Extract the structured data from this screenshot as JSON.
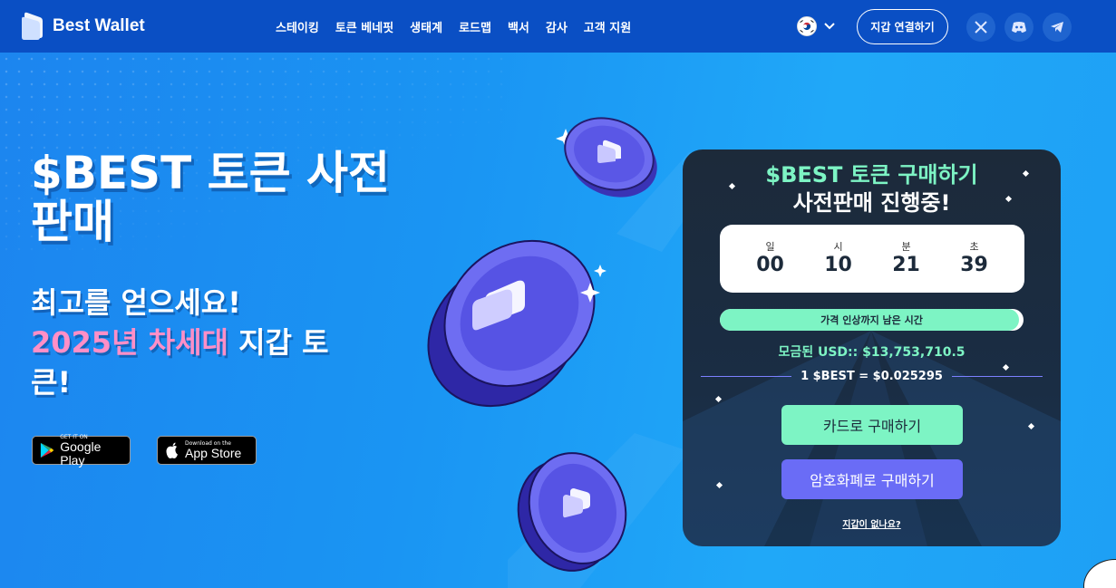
{
  "header": {
    "brand": "Best Wallet",
    "nav": [
      "스테이킹",
      "토큰 베네핏",
      "생태계",
      "로드맵",
      "백서",
      "감사",
      "고객 지원"
    ],
    "connect_label": "지갑 연결하기",
    "language_icon": "korea-flag-icon",
    "social_icons": [
      "x-icon",
      "discord-icon",
      "telegram-icon"
    ]
  },
  "hero": {
    "title": "$BEST 토큰 사전판매",
    "subtitle_line1": "최고를 얻으세요!",
    "subtitle_year": "2025년 차세대",
    "subtitle_rest": " 지갑 토큰!",
    "google_small": "GET IT ON",
    "google_big": "Google Play",
    "apple_small": "Download on the",
    "apple_big": "App Store"
  },
  "presale": {
    "title_highlight": "$BEST",
    "title_rest": " 토큰 구매하기",
    "title_line2": "사전판매 진행중!",
    "timer": [
      {
        "label": "일",
        "value": "00"
      },
      {
        "label": "시",
        "value": "10"
      },
      {
        "label": "분",
        "value": "21"
      },
      {
        "label": "초",
        "value": "39"
      }
    ],
    "progress_label": "가격 인상까지 남은 시간",
    "progress_fraction": 0.985,
    "raised_label": "모금된 USD::",
    "raised_value": " $13,753,710.5",
    "rate": "1 $BEST = $0.025295",
    "buy_card_label": "카드로 구매하기",
    "buy_crypto_label": "암호화폐로 구매하기",
    "no_wallet_label": "지갑이 없나요?"
  },
  "colors": {
    "header_bg": "#0a4fc4",
    "accent_green": "#7df4c4",
    "accent_purple": "#6a6cf6",
    "pink": "#ff8fc7",
    "card_bg": "#1c2a3a"
  }
}
